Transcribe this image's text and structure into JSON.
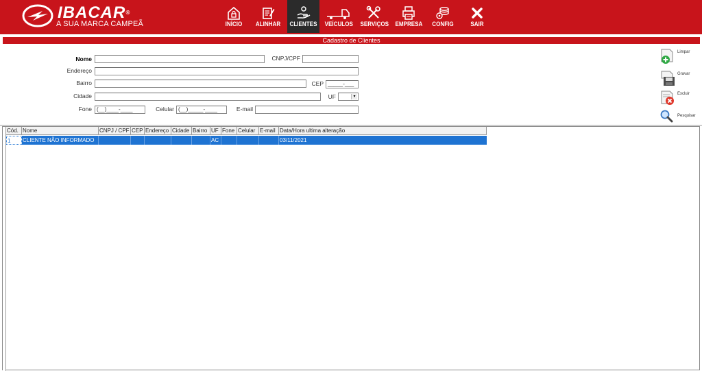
{
  "brand": {
    "name": "IBACAR",
    "tagline": "A SUA MARCA CAMPEÃ"
  },
  "nav": [
    {
      "label": "INÍCIO",
      "icon": "home-lock-icon",
      "active": false
    },
    {
      "label": "ALINHAR",
      "icon": "edit-document-icon",
      "active": false
    },
    {
      "label": "CLIENTES",
      "icon": "hand-person-icon",
      "active": true
    },
    {
      "label": "VEÍCULOS",
      "icon": "truck-icon",
      "active": false
    },
    {
      "label": "SERVIÇOS",
      "icon": "tools-icon",
      "active": false
    },
    {
      "label": "EMPRESA",
      "icon": "printer-icon",
      "active": false
    },
    {
      "label": "CONFIG",
      "icon": "coins-gear-icon",
      "active": false
    },
    {
      "label": "SAIR",
      "icon": "close-x-icon",
      "active": false
    }
  ],
  "form": {
    "title": "Cadastro de Clientes",
    "labels": {
      "nome": "Nome",
      "cnpj": "CNPJ/CPF",
      "endereco": "Endereço",
      "bairro": "Bairro",
      "cep": "CEP",
      "cidade": "Cidade",
      "uf": "UF",
      "fone": "Fone",
      "celular": "Celular",
      "email": "E-mail"
    },
    "values": {
      "nome": "",
      "cnpj": "",
      "endereco": "",
      "bairro": "",
      "cep": "_____-___",
      "cidade": "",
      "uf": "",
      "fone": "(__)____-____",
      "celular": "(__)_____-____",
      "email": ""
    }
  },
  "actions": [
    {
      "label": "Limpar",
      "icon": "document-add-icon"
    },
    {
      "label": "Gravar",
      "icon": "save-disk-icon"
    },
    {
      "label": "Excluir",
      "icon": "document-delete-icon"
    },
    {
      "label": "Pesquisar",
      "icon": "magnifier-icon"
    }
  ],
  "grid": {
    "columns": [
      "Cód.",
      "Nome",
      "CNPJ / CPF",
      "CEP",
      "Endereço",
      "Cidade",
      "Bairro",
      "UF",
      "Fone",
      "Celular",
      "E-mail",
      "Data/Hora ultima alteração"
    ],
    "rows": [
      [
        "1",
        "CLIENTE NÃO INFORMADO",
        "",
        "",
        "",
        "",
        "",
        "AC",
        "",
        "",
        "",
        "03/11/2021"
      ]
    ]
  },
  "colors": {
    "brand_red": "#c8141b",
    "nav_active": "#2b2b2b",
    "selection_blue": "#1e73d2"
  }
}
